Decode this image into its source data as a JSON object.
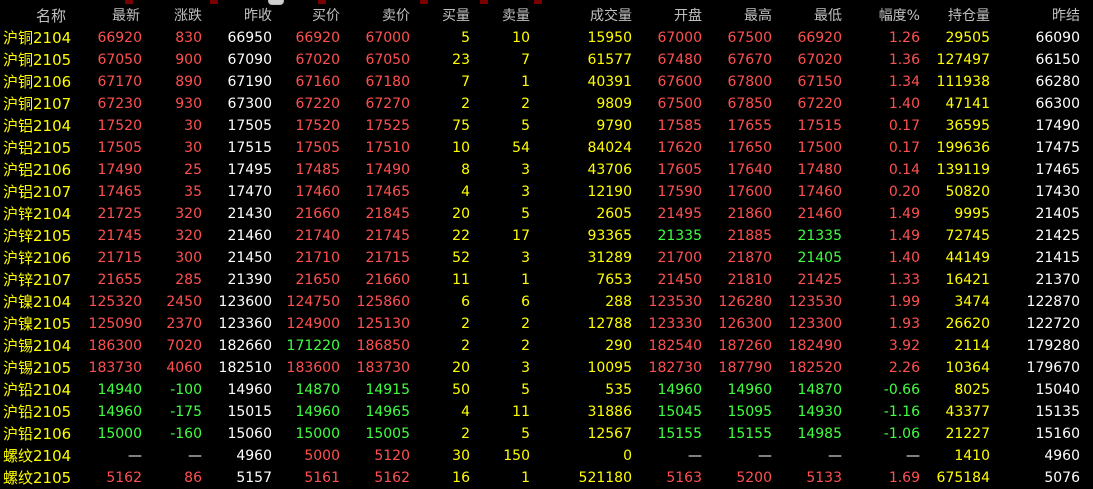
{
  "columns": [
    "名称",
    "最新",
    "涨跌",
    "昨收",
    "买价",
    "卖价",
    "买量",
    "卖量",
    "成交量",
    "开盘",
    "最高",
    "最低",
    "幅度%",
    "持仓量",
    "昨结"
  ],
  "rows": [
    {
      "name": "沪铜2104",
      "last": "66920",
      "chg": "830",
      "pclose": "66950",
      "bid": "66920",
      "ask": "67000",
      "bidv": "5",
      "askv": "10",
      "vol": "15950",
      "open": "67000",
      "high": "67500",
      "low": "66920",
      "pct": "1.26",
      "oi": "29505",
      "psettle": "66090",
      "c": {
        "last": "up",
        "chg": "up",
        "bid": "up",
        "ask": "up",
        "open": "up",
        "high": "up",
        "low": "up",
        "pct": "up"
      }
    },
    {
      "name": "沪铜2105",
      "last": "67050",
      "chg": "900",
      "pclose": "67090",
      "bid": "67020",
      "ask": "67050",
      "bidv": "23",
      "askv": "7",
      "vol": "61577",
      "open": "67480",
      "high": "67670",
      "low": "67020",
      "pct": "1.36",
      "oi": "127497",
      "psettle": "66150",
      "c": {
        "last": "up",
        "chg": "up",
        "bid": "up",
        "ask": "up",
        "open": "up",
        "high": "up",
        "low": "up",
        "pct": "up"
      }
    },
    {
      "name": "沪铜2106",
      "last": "67170",
      "chg": "890",
      "pclose": "67190",
      "bid": "67160",
      "ask": "67180",
      "bidv": "7",
      "askv": "1",
      "vol": "40391",
      "open": "67600",
      "high": "67800",
      "low": "67150",
      "pct": "1.34",
      "oi": "111938",
      "psettle": "66280",
      "c": {
        "last": "up",
        "chg": "up",
        "bid": "up",
        "ask": "up",
        "open": "up",
        "high": "up",
        "low": "up",
        "pct": "up"
      }
    },
    {
      "name": "沪铜2107",
      "last": "67230",
      "chg": "930",
      "pclose": "67300",
      "bid": "67220",
      "ask": "67270",
      "bidv": "2",
      "askv": "2",
      "vol": "9809",
      "open": "67500",
      "high": "67850",
      "low": "67220",
      "pct": "1.40",
      "oi": "47141",
      "psettle": "66300",
      "c": {
        "last": "up",
        "chg": "up",
        "bid": "up",
        "ask": "up",
        "open": "up",
        "high": "up",
        "low": "up",
        "pct": "up"
      }
    },
    {
      "name": "沪铝2104",
      "last": "17520",
      "chg": "30",
      "pclose": "17505",
      "bid": "17520",
      "ask": "17525",
      "bidv": "75",
      "askv": "5",
      "vol": "9790",
      "open": "17585",
      "high": "17655",
      "low": "17515",
      "pct": "0.17",
      "oi": "36595",
      "psettle": "17490",
      "c": {
        "last": "up",
        "chg": "up",
        "bid": "up",
        "ask": "up",
        "open": "up",
        "high": "up",
        "low": "up",
        "pct": "up"
      }
    },
    {
      "name": "沪铝2105",
      "last": "17505",
      "chg": "30",
      "pclose": "17515",
      "bid": "17505",
      "ask": "17510",
      "bidv": "10",
      "askv": "54",
      "vol": "84024",
      "open": "17620",
      "high": "17650",
      "low": "17500",
      "pct": "0.17",
      "oi": "199636",
      "psettle": "17475",
      "c": {
        "last": "up",
        "chg": "up",
        "bid": "up",
        "ask": "up",
        "open": "up",
        "high": "up",
        "low": "up",
        "pct": "up"
      }
    },
    {
      "name": "沪铝2106",
      "last": "17490",
      "chg": "25",
      "pclose": "17495",
      "bid": "17485",
      "ask": "17490",
      "bidv": "8",
      "askv": "3",
      "vol": "43706",
      "open": "17605",
      "high": "17640",
      "low": "17480",
      "pct": "0.14",
      "oi": "139119",
      "psettle": "17465",
      "c": {
        "last": "up",
        "chg": "up",
        "bid": "up",
        "ask": "up",
        "open": "up",
        "high": "up",
        "low": "up",
        "pct": "up"
      }
    },
    {
      "name": "沪铝2107",
      "last": "17465",
      "chg": "35",
      "pclose": "17470",
      "bid": "17460",
      "ask": "17465",
      "bidv": "4",
      "askv": "3",
      "vol": "12190",
      "open": "17590",
      "high": "17600",
      "low": "17460",
      "pct": "0.20",
      "oi": "50820",
      "psettle": "17430",
      "c": {
        "last": "up",
        "chg": "up",
        "bid": "up",
        "ask": "up",
        "open": "up",
        "high": "up",
        "low": "up",
        "pct": "up"
      }
    },
    {
      "name": "沪锌2104",
      "last": "21725",
      "chg": "320",
      "pclose": "21430",
      "bid": "21660",
      "ask": "21845",
      "bidv": "20",
      "askv": "5",
      "vol": "2605",
      "open": "21495",
      "high": "21860",
      "low": "21460",
      "pct": "1.49",
      "oi": "9995",
      "psettle": "21405",
      "c": {
        "last": "up",
        "chg": "up",
        "bid": "up",
        "ask": "up",
        "open": "up",
        "high": "up",
        "low": "up",
        "pct": "up"
      }
    },
    {
      "name": "沪锌2105",
      "last": "21745",
      "chg": "320",
      "pclose": "21460",
      "bid": "21740",
      "ask": "21745",
      "bidv": "22",
      "askv": "17",
      "vol": "93365",
      "open": "21335",
      "high": "21885",
      "low": "21335",
      "pct": "1.49",
      "oi": "72745",
      "psettle": "21425",
      "c": {
        "last": "up",
        "chg": "up",
        "bid": "up",
        "ask": "up",
        "open": "down",
        "high": "up",
        "low": "down",
        "pct": "up"
      }
    },
    {
      "name": "沪锌2106",
      "last": "21715",
      "chg": "300",
      "pclose": "21450",
      "bid": "21710",
      "ask": "21715",
      "bidv": "52",
      "askv": "3",
      "vol": "31289",
      "open": "21700",
      "high": "21870",
      "low": "21405",
      "pct": "1.40",
      "oi": "44149",
      "psettle": "21415",
      "c": {
        "last": "up",
        "chg": "up",
        "bid": "up",
        "ask": "up",
        "open": "up",
        "high": "up",
        "low": "down",
        "pct": "up"
      }
    },
    {
      "name": "沪锌2107",
      "last": "21655",
      "chg": "285",
      "pclose": "21390",
      "bid": "21650",
      "ask": "21660",
      "bidv": "11",
      "askv": "1",
      "vol": "7653",
      "open": "21450",
      "high": "21810",
      "low": "21425",
      "pct": "1.33",
      "oi": "16421",
      "psettle": "21370",
      "c": {
        "last": "up",
        "chg": "up",
        "bid": "up",
        "ask": "up",
        "open": "up",
        "high": "up",
        "low": "up",
        "pct": "up"
      }
    },
    {
      "name": "沪镍2104",
      "last": "125320",
      "chg": "2450",
      "pclose": "123600",
      "bid": "124750",
      "ask": "125860",
      "bidv": "6",
      "askv": "6",
      "vol": "288",
      "open": "123530",
      "high": "126280",
      "low": "123530",
      "pct": "1.99",
      "oi": "3474",
      "psettle": "122870",
      "c": {
        "last": "up",
        "chg": "up",
        "bid": "up",
        "ask": "up",
        "open": "up",
        "high": "up",
        "low": "up",
        "pct": "up"
      }
    },
    {
      "name": "沪镍2105",
      "last": "125090",
      "chg": "2370",
      "pclose": "123360",
      "bid": "124900",
      "ask": "125130",
      "bidv": "2",
      "askv": "2",
      "vol": "12788",
      "open": "123330",
      "high": "126300",
      "low": "123300",
      "pct": "1.93",
      "oi": "26620",
      "psettle": "122720",
      "c": {
        "last": "up",
        "chg": "up",
        "bid": "up",
        "ask": "up",
        "open": "up",
        "high": "up",
        "low": "up",
        "pct": "up"
      }
    },
    {
      "name": "沪锡2104",
      "last": "186300",
      "chg": "7020",
      "pclose": "182660",
      "bid": "171220",
      "ask": "186850",
      "bidv": "2",
      "askv": "2",
      "vol": "290",
      "open": "182540",
      "high": "187260",
      "low": "182490",
      "pct": "3.92",
      "oi": "2114",
      "psettle": "179280",
      "c": {
        "last": "up",
        "chg": "up",
        "bid": "down",
        "ask": "up",
        "open": "up",
        "high": "up",
        "low": "up",
        "pct": "up"
      }
    },
    {
      "name": "沪锡2105",
      "last": "183730",
      "chg": "4060",
      "pclose": "182510",
      "bid": "183600",
      "ask": "183730",
      "bidv": "20",
      "askv": "3",
      "vol": "10095",
      "open": "182730",
      "high": "187790",
      "low": "182520",
      "pct": "2.26",
      "oi": "10364",
      "psettle": "179670",
      "c": {
        "last": "up",
        "chg": "up",
        "bid": "up",
        "ask": "up",
        "open": "up",
        "high": "up",
        "low": "up",
        "pct": "up"
      }
    },
    {
      "name": "沪铅2104",
      "last": "14940",
      "chg": "-100",
      "pclose": "14960",
      "bid": "14870",
      "ask": "14915",
      "bidv": "50",
      "askv": "5",
      "vol": "535",
      "open": "14960",
      "high": "14960",
      "low": "14870",
      "pct": "-0.66",
      "oi": "8025",
      "psettle": "15040",
      "c": {
        "last": "down",
        "chg": "down",
        "bid": "down",
        "ask": "down",
        "open": "down",
        "high": "down",
        "low": "down",
        "pct": "down"
      }
    },
    {
      "name": "沪铅2105",
      "last": "14960",
      "chg": "-175",
      "pclose": "15015",
      "bid": "14960",
      "ask": "14965",
      "bidv": "4",
      "askv": "11",
      "vol": "31886",
      "open": "15045",
      "high": "15095",
      "low": "14930",
      "pct": "-1.16",
      "oi": "43377",
      "psettle": "15135",
      "c": {
        "last": "down",
        "chg": "down",
        "bid": "down",
        "ask": "down",
        "open": "down",
        "high": "down",
        "low": "down",
        "pct": "down"
      }
    },
    {
      "name": "沪铅2106",
      "last": "15000",
      "chg": "-160",
      "pclose": "15060",
      "bid": "15000",
      "ask": "15005",
      "bidv": "2",
      "askv": "5",
      "vol": "12567",
      "open": "15155",
      "high": "15155",
      "low": "14985",
      "pct": "-1.06",
      "oi": "21227",
      "psettle": "15160",
      "c": {
        "last": "down",
        "chg": "down",
        "bid": "down",
        "ask": "down",
        "open": "down",
        "high": "down",
        "low": "down",
        "pct": "down"
      }
    },
    {
      "name": "螺纹2104",
      "last": "—",
      "chg": "—",
      "pclose": "4960",
      "bid": "5000",
      "ask": "5120",
      "bidv": "30",
      "askv": "150",
      "vol": "0",
      "open": "—",
      "high": "—",
      "low": "—",
      "pct": "—",
      "oi": "1410",
      "psettle": "4960",
      "c": {
        "last": "flat",
        "chg": "flat",
        "bid": "up",
        "ask": "up",
        "open": "flat",
        "high": "flat",
        "low": "flat",
        "pct": "flat"
      }
    },
    {
      "name": "螺纹2105",
      "last": "5162",
      "chg": "86",
      "pclose": "5157",
      "bid": "5161",
      "ask": "5162",
      "bidv": "16",
      "askv": "1",
      "vol": "521180",
      "open": "5163",
      "high": "5200",
      "low": "5133",
      "pct": "1.69",
      "oi": "675184",
      "psettle": "5076",
      "c": {
        "last": "up",
        "chg": "up",
        "bid": "up",
        "ask": "up",
        "open": "up",
        "high": "up",
        "low": "up",
        "pct": "up"
      }
    }
  ],
  "colors": {
    "up": "#ff5050",
    "down": "#40ff40",
    "flat": "#ffffff",
    "volume": "#ffff00",
    "name": "#ffff00",
    "header": "#c0c0c0",
    "background": "#000000"
  }
}
